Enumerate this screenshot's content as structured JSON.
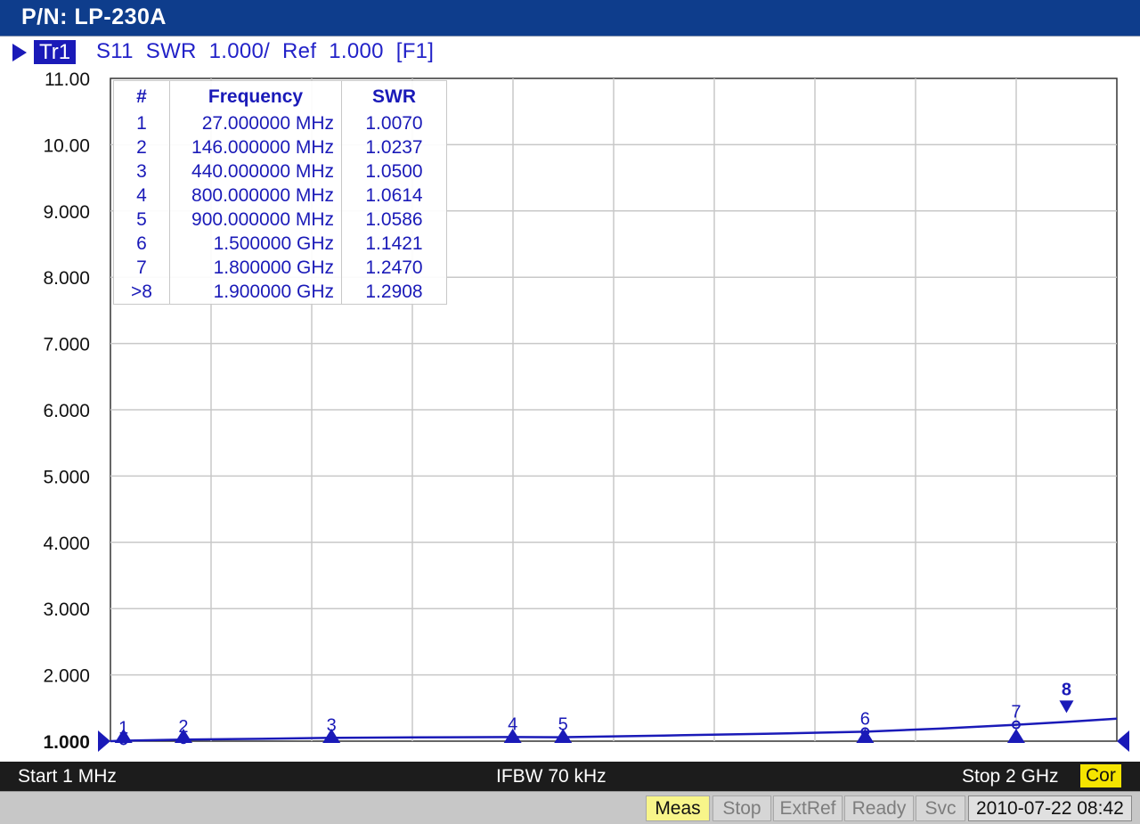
{
  "window": {
    "title": "P/N: LP-230A"
  },
  "trace": {
    "id": "Tr1",
    "description": "S11  SWR  1.000/  Ref  1.000  [F1]",
    "color": "#1a1ab8"
  },
  "marker_table": {
    "headers": [
      "#",
      "Frequency",
      "SWR"
    ],
    "rows": [
      [
        "1",
        "27.000000 MHz",
        "1.0070"
      ],
      [
        "2",
        "146.000000 MHz",
        "1.0237"
      ],
      [
        "3",
        "440.000000 MHz",
        "1.0500"
      ],
      [
        "4",
        "800.000000 MHz",
        "1.0614"
      ],
      [
        "5",
        "900.000000 MHz",
        "1.0586"
      ],
      [
        "6",
        "1.500000 GHz",
        "1.1421"
      ],
      [
        "7",
        "1.800000 GHz",
        "1.2470"
      ],
      [
        ">8",
        "1.900000 GHz",
        "1.2908"
      ]
    ]
  },
  "chart_data": {
    "type": "line",
    "ylabel": "",
    "xlabel": "",
    "x_unit": "MHz",
    "xlim": [
      1,
      2000
    ],
    "ylim": [
      1,
      11
    ],
    "yticks": [
      "11.00",
      "10.00",
      "9.000",
      "8.000",
      "7.000",
      "6.000",
      "5.000",
      "4.000",
      "3.000",
      "2.000",
      "1.000"
    ],
    "grid": true,
    "series": [
      {
        "x": [
          1,
          27,
          146,
          300,
          440,
          600,
          800,
          900,
          1100,
          1300,
          1500,
          1650,
          1800,
          1900,
          2000
        ],
        "y": [
          1.0,
          1.007,
          1.0237,
          1.035,
          1.05,
          1.058,
          1.0614,
          1.0586,
          1.085,
          1.11,
          1.1421,
          1.19,
          1.247,
          1.2908,
          1.34
        ]
      }
    ],
    "markers": [
      {
        "label": "1",
        "x": 27,
        "y": 1.007
      },
      {
        "label": "2",
        "x": 146,
        "y": 1.0237
      },
      {
        "label": "3",
        "x": 440,
        "y": 1.05
      },
      {
        "label": "4",
        "x": 800,
        "y": 1.0614
      },
      {
        "label": "5",
        "x": 900,
        "y": 1.0586
      },
      {
        "label": "6",
        "x": 1500,
        "y": 1.1421
      },
      {
        "label": "7",
        "x": 1800,
        "y": 1.247
      },
      {
        "label": "8",
        "x": 1900,
        "y": 1.2908,
        "active": true
      }
    ]
  },
  "status": {
    "start": "Start 1 MHz",
    "ifbw": "IFBW 70 kHz",
    "stop": "Stop 2 GHz",
    "cor": "Cor"
  },
  "footer": {
    "meas": "Meas",
    "stop": "Stop",
    "extref": "ExtRef",
    "ready": "Ready",
    "svc": "Svc",
    "datetime": "2010-07-22 08:42"
  }
}
